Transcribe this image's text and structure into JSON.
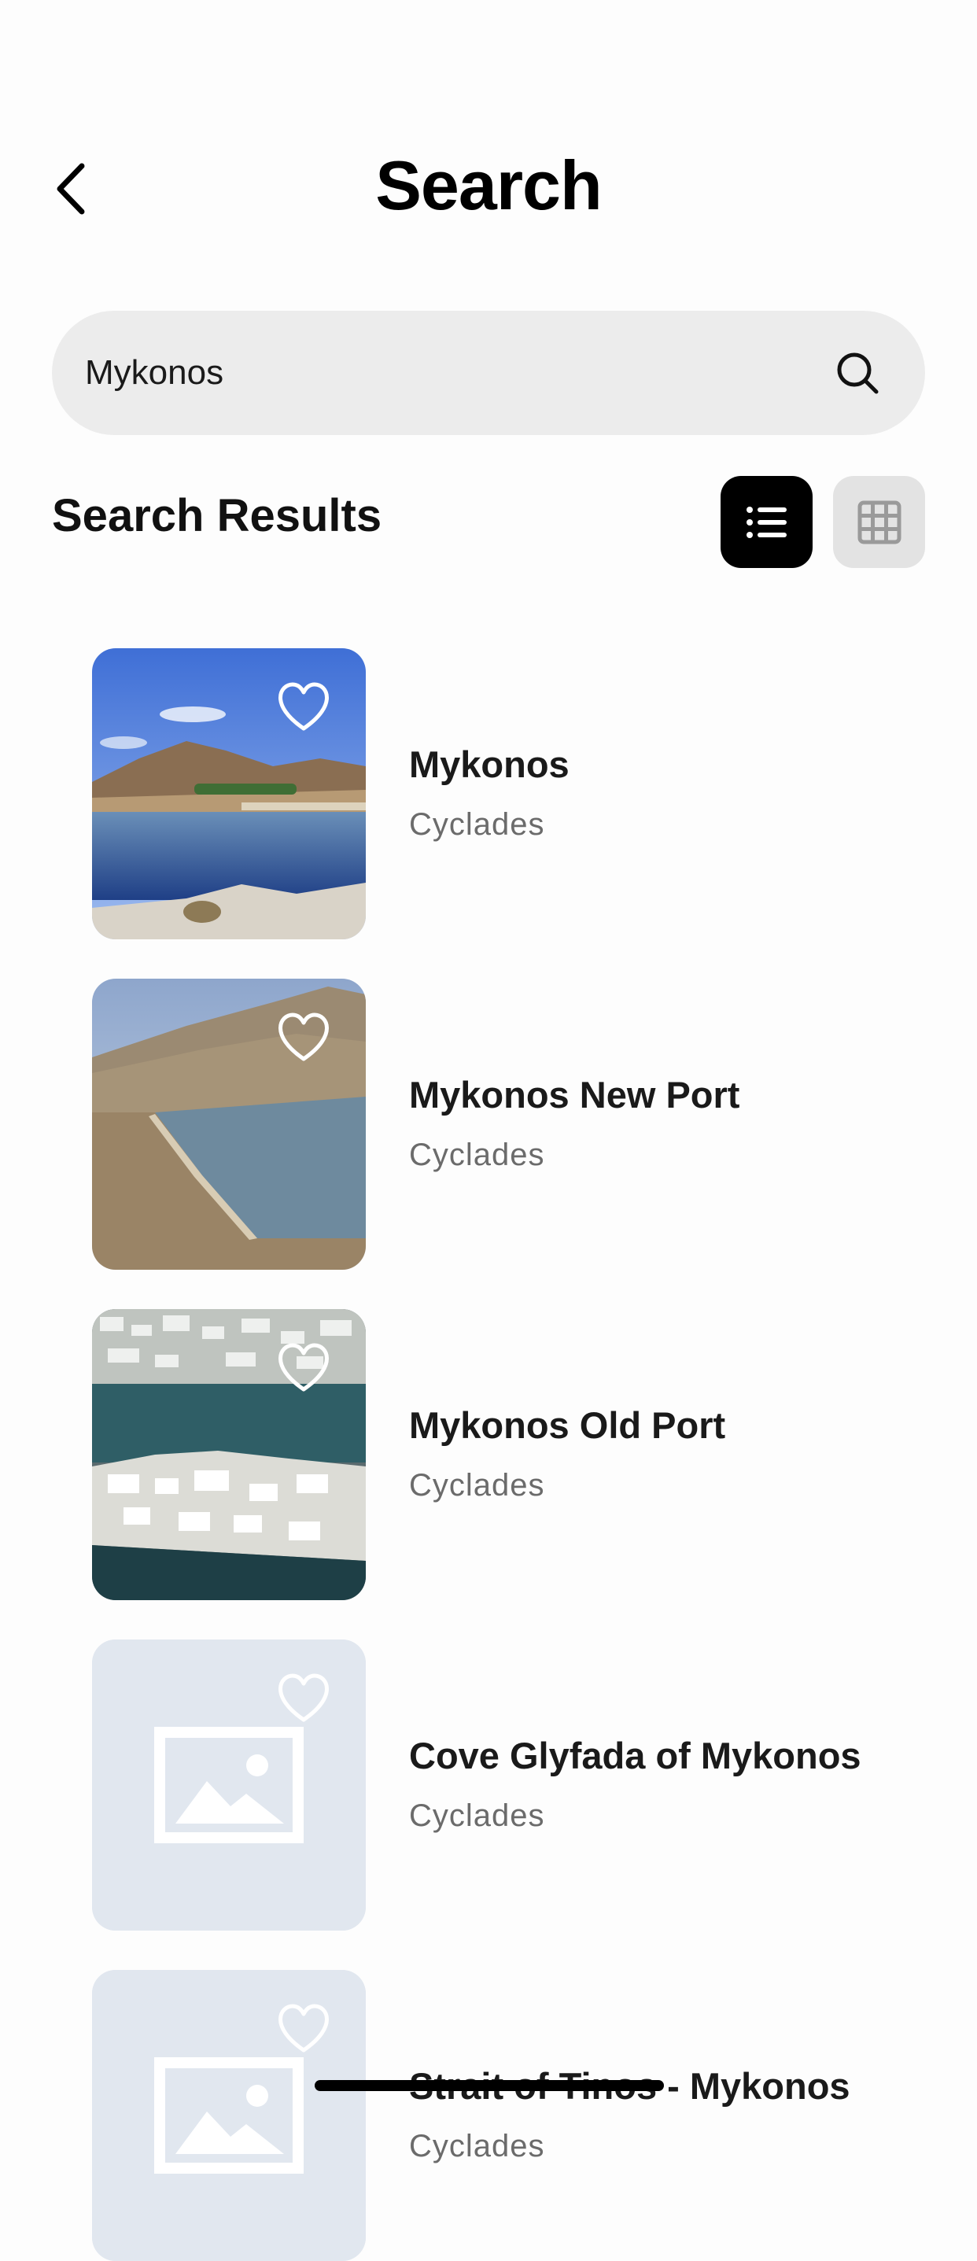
{
  "header": {
    "title": "Search",
    "back_icon": "chevron-left-icon"
  },
  "search": {
    "value": "Mykonos",
    "icon": "search-icon"
  },
  "results": {
    "heading": "Search Results",
    "view_options": [
      {
        "name": "list",
        "icon": "list-icon",
        "active": true
      },
      {
        "name": "grid",
        "icon": "grid-icon",
        "active": false
      }
    ],
    "items": [
      {
        "name": "Mykonos",
        "region": "Cyclades",
        "image": "bay-photo",
        "favorite_icon": "heart-outline-icon"
      },
      {
        "name": "Mykonos New Port",
        "region": "Cyclades",
        "image": "coast-photo",
        "favorite_icon": "heart-outline-icon"
      },
      {
        "name": "Mykonos Old Port",
        "region": "Cyclades",
        "image": "town-photo",
        "favorite_icon": "heart-outline-icon"
      },
      {
        "name": "Cove Glyfada of Mykonos",
        "region": "Cyclades",
        "image": "placeholder-image-icon",
        "favorite_icon": "heart-outline-icon"
      },
      {
        "name": "Strait of Tinos - Mykonos",
        "region": "Cyclades",
        "image": "placeholder-image-icon",
        "favorite_icon": "heart-outline-icon"
      }
    ]
  },
  "colors": {
    "background": "#fdfdfd",
    "search_bg": "#ececec",
    "active_toggle": "#000000",
    "inactive_toggle": "#e3e3e3",
    "placeholder_bg": "#e1e7ef",
    "secondary_text": "#6b6b6b"
  }
}
